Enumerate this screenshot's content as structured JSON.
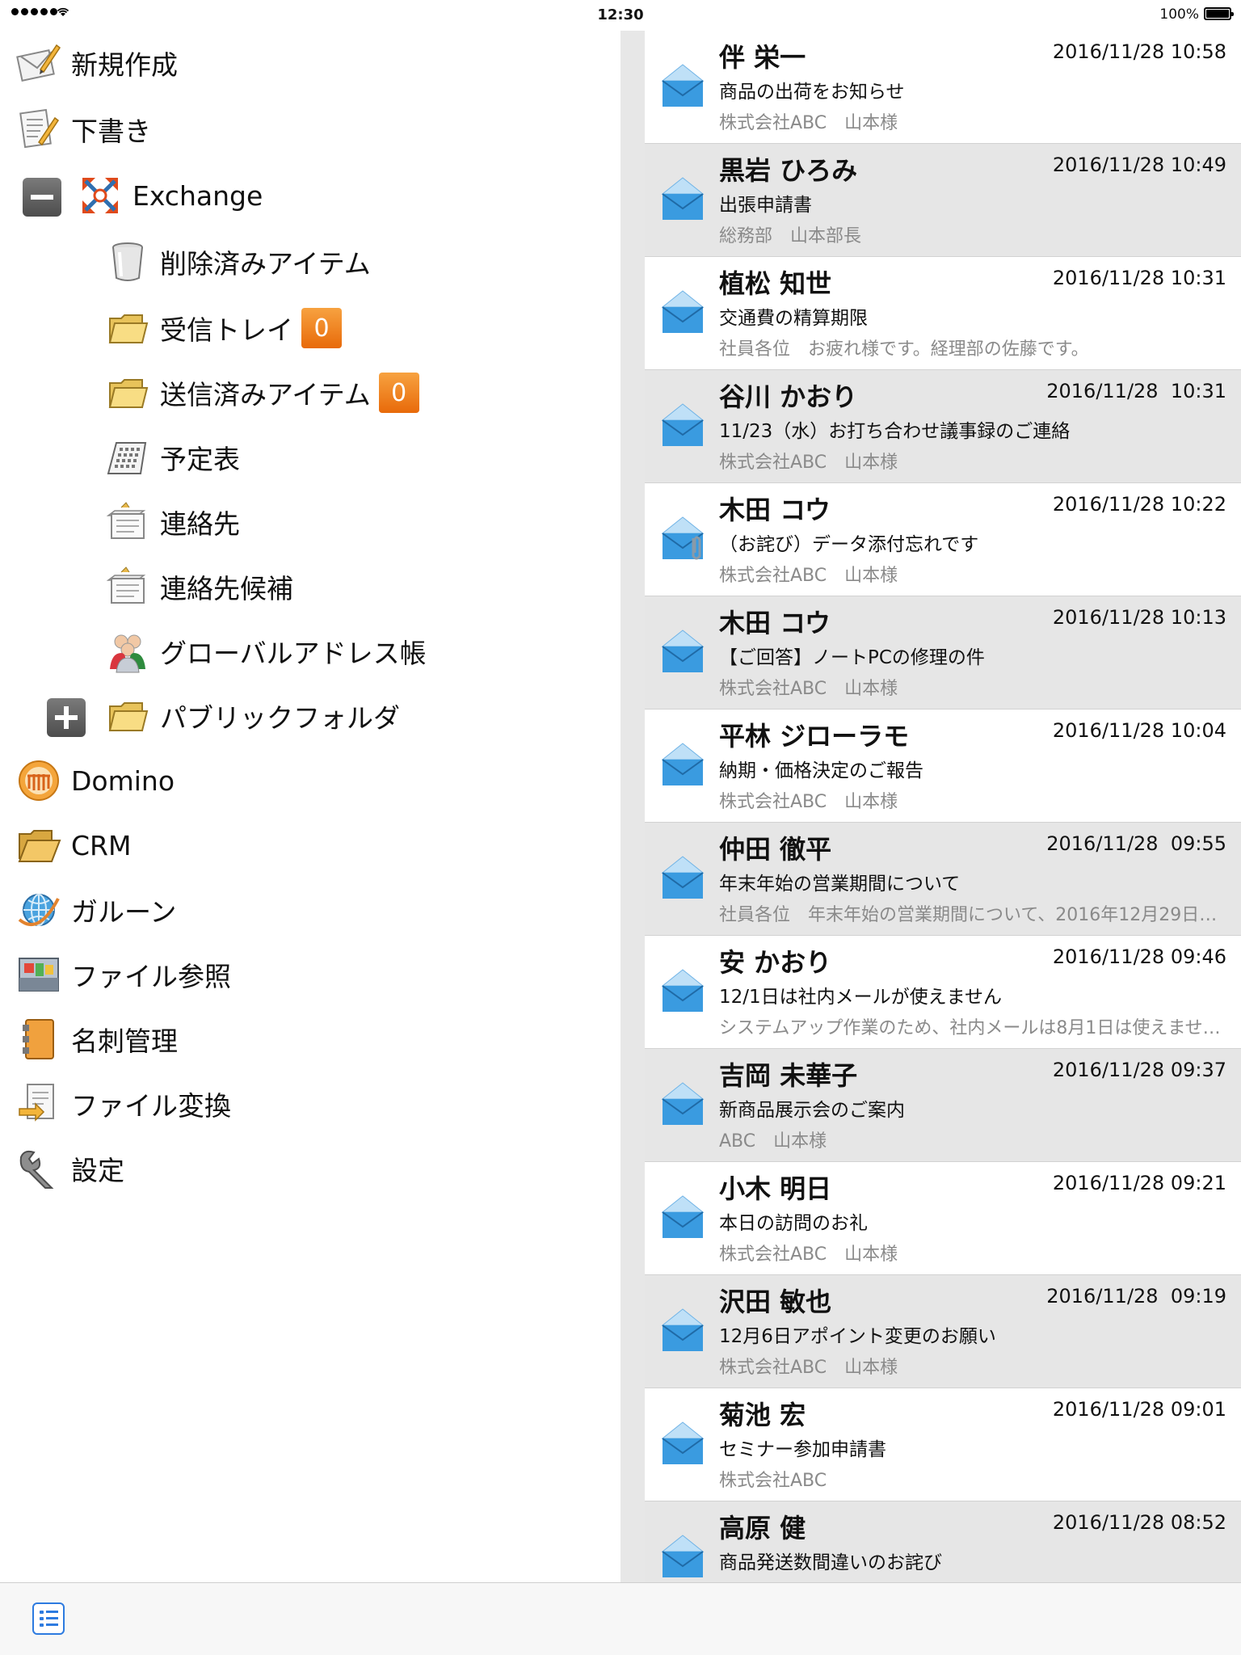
{
  "status_bar": {
    "time": "12:30",
    "battery": "100%"
  },
  "nav": {
    "items": [
      {
        "label": "新規作成",
        "icon": "new-mail-icon"
      },
      {
        "label": "下書き",
        "icon": "drafts-icon"
      },
      {
        "label": "Exchange",
        "icon": "exchange-icon"
      },
      {
        "label": "削除済みアイテム",
        "icon": "trash-icon"
      },
      {
        "label": "受信トレイ",
        "icon": "folder-icon",
        "badge": "0"
      },
      {
        "label": "送信済みアイテム",
        "icon": "folder-icon",
        "badge": "0"
      },
      {
        "label": "予定表",
        "icon": "calendar-icon"
      },
      {
        "label": "連絡先",
        "icon": "contacts-icon"
      },
      {
        "label": "連絡先候補",
        "icon": "contacts-icon"
      },
      {
        "label": "グローバルアドレス帳",
        "icon": "people-icon"
      },
      {
        "label": "パブリックフォルダ",
        "icon": "folder-icon"
      },
      {
        "label": "Domino",
        "icon": "domino-icon"
      },
      {
        "label": "CRM",
        "icon": "open-folder-icon"
      },
      {
        "label": "ガルーン",
        "icon": "globe-icon"
      },
      {
        "label": "ファイル参照",
        "icon": "file-browser-icon"
      },
      {
        "label": "名刺管理",
        "icon": "business-card-icon"
      },
      {
        "label": "ファイル変換",
        "icon": "file-convert-icon"
      },
      {
        "label": "設定",
        "icon": "wrench-icon"
      }
    ]
  },
  "mails": [
    {
      "sender": "伴 栄一",
      "date": "2016/11/28 10:58",
      "subject": "商品の出荷をお知らせ",
      "preview": "株式会社ABC　山本様",
      "attachment": false
    },
    {
      "sender": "黒岩 ひろみ",
      "date": "2016/11/28 10:49",
      "subject": "出張申請書",
      "preview": "総務部　山本部長",
      "attachment": false
    },
    {
      "sender": "植松 知世",
      "date": "2016/11/28 10:31",
      "subject": "交通費の精算期限",
      "preview": "社員各位　お疲れ様です。経理部の佐藤です。",
      "attachment": false
    },
    {
      "sender": "谷川 かおり",
      "date": "2016/11/28  10:31",
      "subject": "11/23（水）お打ち合わせ議事録のご連絡",
      "preview": "株式会社ABC　山本様",
      "attachment": false
    },
    {
      "sender": "木田 コウ",
      "date": "2016/11/28 10:22",
      "subject": "（お詫び）データ添付忘れです",
      "preview": "株式会社ABC　山本様",
      "attachment": true
    },
    {
      "sender": "木田 コウ",
      "date": "2016/11/28 10:13",
      "subject": "【ご回答】ノートPCの修理の件",
      "preview": "株式会社ABC　山本様",
      "attachment": false
    },
    {
      "sender": "平林 ジローラモ",
      "date": "2016/11/28 10:04",
      "subject": "納期・価格決定のご報告",
      "preview": "株式会社ABC　山本様",
      "attachment": false
    },
    {
      "sender": "仲田 徹平",
      "date": "2016/11/28  09:55",
      "subject": "年末年始の営業期間について",
      "preview": "社員各位　年末年始の営業期間について、2016年12月29日…",
      "attachment": false
    },
    {
      "sender": "安 かおり",
      "date": "2016/11/28 09:46",
      "subject": "12/1日は社内メールが使えません",
      "preview": "システムアップ作業のため、社内メールは8月1日は使えませ…",
      "attachment": false
    },
    {
      "sender": "吉岡 未華子",
      "date": "2016/11/28 09:37",
      "subject": "新商品展示会のご案内",
      "preview": "ABC　山本様",
      "attachment": false
    },
    {
      "sender": "小木 明日",
      "date": "2016/11/28 09:21",
      "subject": "本日の訪問のお礼",
      "preview": "株式会社ABC　山本様",
      "attachment": false
    },
    {
      "sender": "沢田 敏也",
      "date": "2016/11/28  09:19",
      "subject": "12月6日アポイント変更のお願い",
      "preview": "株式会社ABC　山本様",
      "attachment": false
    },
    {
      "sender": "菊池 宏",
      "date": "2016/11/28 09:01",
      "subject": "セミナー参加申請書",
      "preview": "株式会社ABC",
      "attachment": false
    },
    {
      "sender": "高原 健",
      "date": "2016/11/28 08:52",
      "subject": "商品発送数間違いのお詫び",
      "preview": "",
      "attachment": false
    }
  ],
  "colors": {
    "badge": "#f07a1a",
    "envelope": "#3a9be0",
    "row_shade": "#e6e6e6",
    "toolbar_accent": "#2d7be0"
  }
}
